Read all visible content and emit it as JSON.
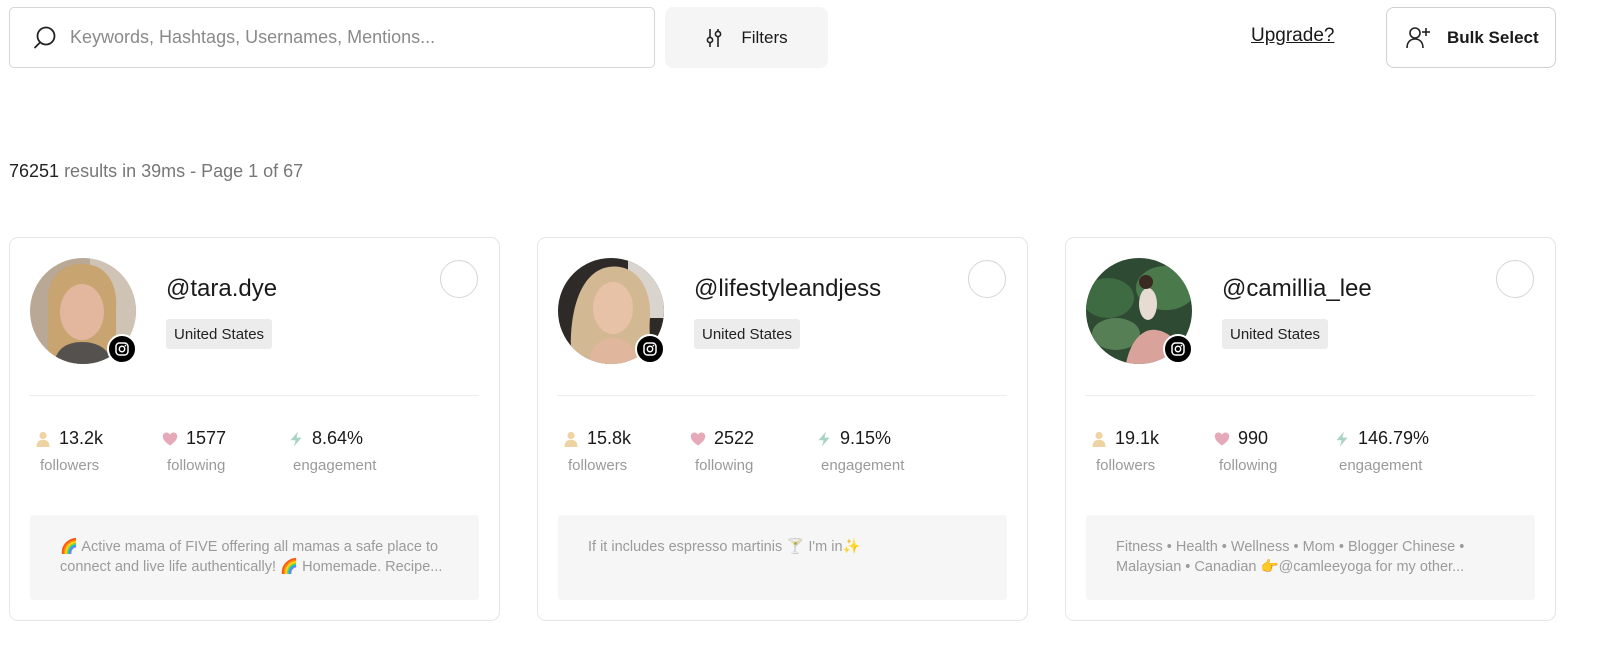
{
  "search": {
    "placeholder": "Keywords, Hashtags, Usernames, Mentions...",
    "value": ""
  },
  "toolbar": {
    "filters_label": "Filters",
    "upgrade_label": "Upgrade?",
    "bulk_label": "Bulk Select"
  },
  "results": {
    "count": "76251",
    "rest": " results in 39ms - Page 1 of 67"
  },
  "colors": {
    "follower_icon": "#f0d3a3",
    "following_icon": "#e6a9b9",
    "engagement_icon": "#a9d3c3"
  },
  "cards": [
    {
      "handle": "@tara.dye",
      "country": "United States",
      "followers": "13.2k",
      "following": "1577",
      "engagement": "8.64%",
      "followers_label": "followers",
      "following_label": "following",
      "engagement_label": "engagement",
      "bio": "🌈 Active mama of FIVE offering all mamas a safe place to connect and live life authentically! 🌈 Homemade. Recipe..."
    },
    {
      "handle": "@lifestyleandjess",
      "country": "United States",
      "followers": "15.8k",
      "following": "2522",
      "engagement": "9.15%",
      "followers_label": "followers",
      "following_label": "following",
      "engagement_label": "engagement",
      "bio": "If it includes espresso martinis 🍸 I'm in✨"
    },
    {
      "handle": "@camillia_lee",
      "country": "United States",
      "followers": "19.1k",
      "following": "990",
      "engagement": "146.79%",
      "followers_label": "followers",
      "following_label": "following",
      "engagement_label": "engagement",
      "bio": "Fitness • Health • Wellness • Mom • Blogger Chinese • Malaysian • Canadian 👉@camleeyoga for my other..."
    }
  ]
}
